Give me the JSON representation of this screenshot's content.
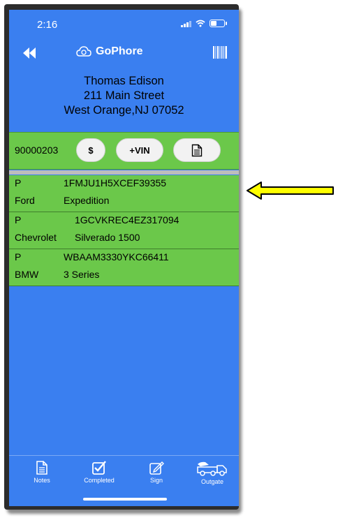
{
  "status_bar": {
    "time": "2:16"
  },
  "nav": {
    "app_name": "GoPhore",
    "back_icon": "rewind-double-chevron-icon",
    "barcode_icon": "barcode-icon"
  },
  "customer": {
    "name": "Thomas Edison",
    "street": "211 Main Street",
    "city_line": "West Orange,NJ 07052"
  },
  "order": {
    "number": "90000203",
    "dollar_label": "$",
    "vin_label": "+VIN",
    "doc_icon": "document-icon"
  },
  "vehicles": [
    {
      "type": "P",
      "vin": "1FMJU1H5XCEF39355",
      "make": "Ford",
      "model": "Expedition"
    },
    {
      "type": "P",
      "vin": "1GCVKREC4EZ317094",
      "make": "Chevrolet",
      "model": "Silverado 1500"
    },
    {
      "type": "P",
      "vin": "WBAAM3330YKC66411",
      "make": "BMW",
      "model": "3 Series"
    }
  ],
  "tabs": [
    {
      "label": "Notes",
      "icon": "notes-icon"
    },
    {
      "label": "Completed",
      "icon": "checkbox-icon"
    },
    {
      "label": "Sign",
      "icon": "sign-pen-icon"
    },
    {
      "label": "Outgate",
      "icon": "tow-truck-icon"
    }
  ],
  "colors": {
    "screen_blue": "#3a7ff0",
    "row_green": "#6bc84a",
    "arrow_yellow": "#ffff00"
  }
}
